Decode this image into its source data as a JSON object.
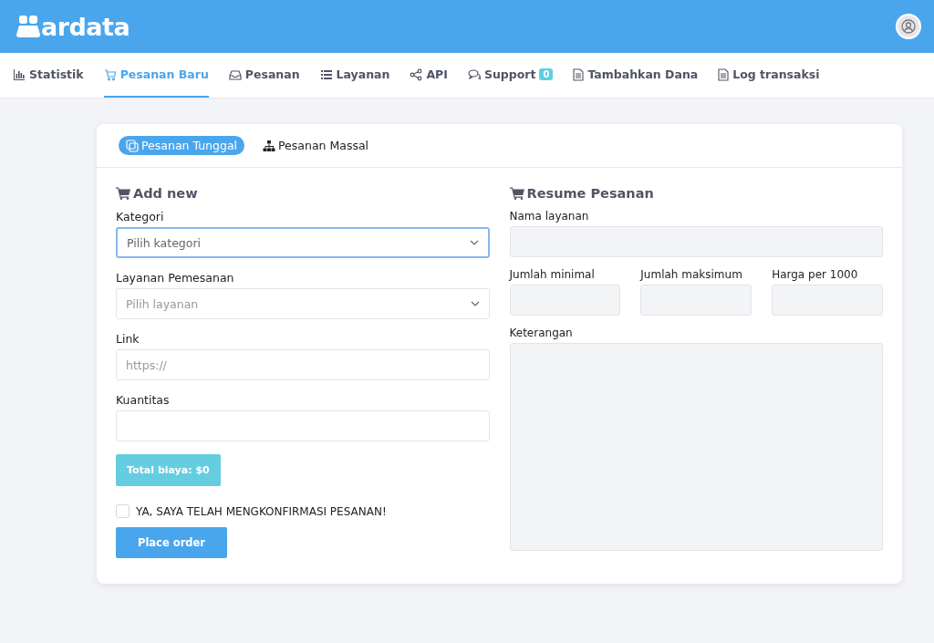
{
  "header": {
    "logo": "ardata"
  },
  "nav": [
    {
      "label": "Statistik",
      "kind": "chart",
      "selected": false
    },
    {
      "label": "Pesanan Baru",
      "kind": "cart",
      "selected": true
    },
    {
      "label": "Pesanan",
      "kind": "inbox",
      "selected": false
    },
    {
      "label": "Layanan",
      "kind": "list",
      "selected": false
    },
    {
      "label": "API",
      "kind": "share",
      "selected": false
    },
    {
      "label": "Support",
      "kind": "chat",
      "selected": false,
      "badge": "0"
    },
    {
      "label": "Tambahkan Dana",
      "kind": "file",
      "selected": false
    },
    {
      "label": "Log transaksi",
      "kind": "file",
      "selected": false
    }
  ],
  "order_tabs": [
    {
      "label": "Pesanan Tunggal",
      "kind": "copy",
      "selected": true
    },
    {
      "label": "Pesanan Massal",
      "kind": "sitemap",
      "selected": false
    }
  ],
  "add_new": {
    "title": "Add new",
    "fields": [
      {
        "label": "Kategori",
        "kind": "select",
        "placeholder": "Pilih kategori",
        "focused": true
      },
      {
        "label": "Layanan Pemesanan",
        "kind": "select",
        "placeholder": "Pilih layanan",
        "focused": false
      },
      {
        "label": "Link",
        "kind": "input",
        "placeholder": "https://",
        "focused": false
      },
      {
        "label": "Kuantitas",
        "kind": "input",
        "focused": false
      }
    ],
    "total": "Total biaya: $0",
    "confirm": {
      "label": "YA, SAYA TELAH MENGKONFIRMASI PESANAN!",
      "checked": false
    },
    "submit": "Place order"
  },
  "resume": {
    "title": "Resume Pesanan",
    "service_label": "Nama layanan",
    "stats": [
      "Jumlah minimal",
      "Jumlah maksimum",
      "Harga per 1000"
    ],
    "notes_label": "Keterangan"
  }
}
